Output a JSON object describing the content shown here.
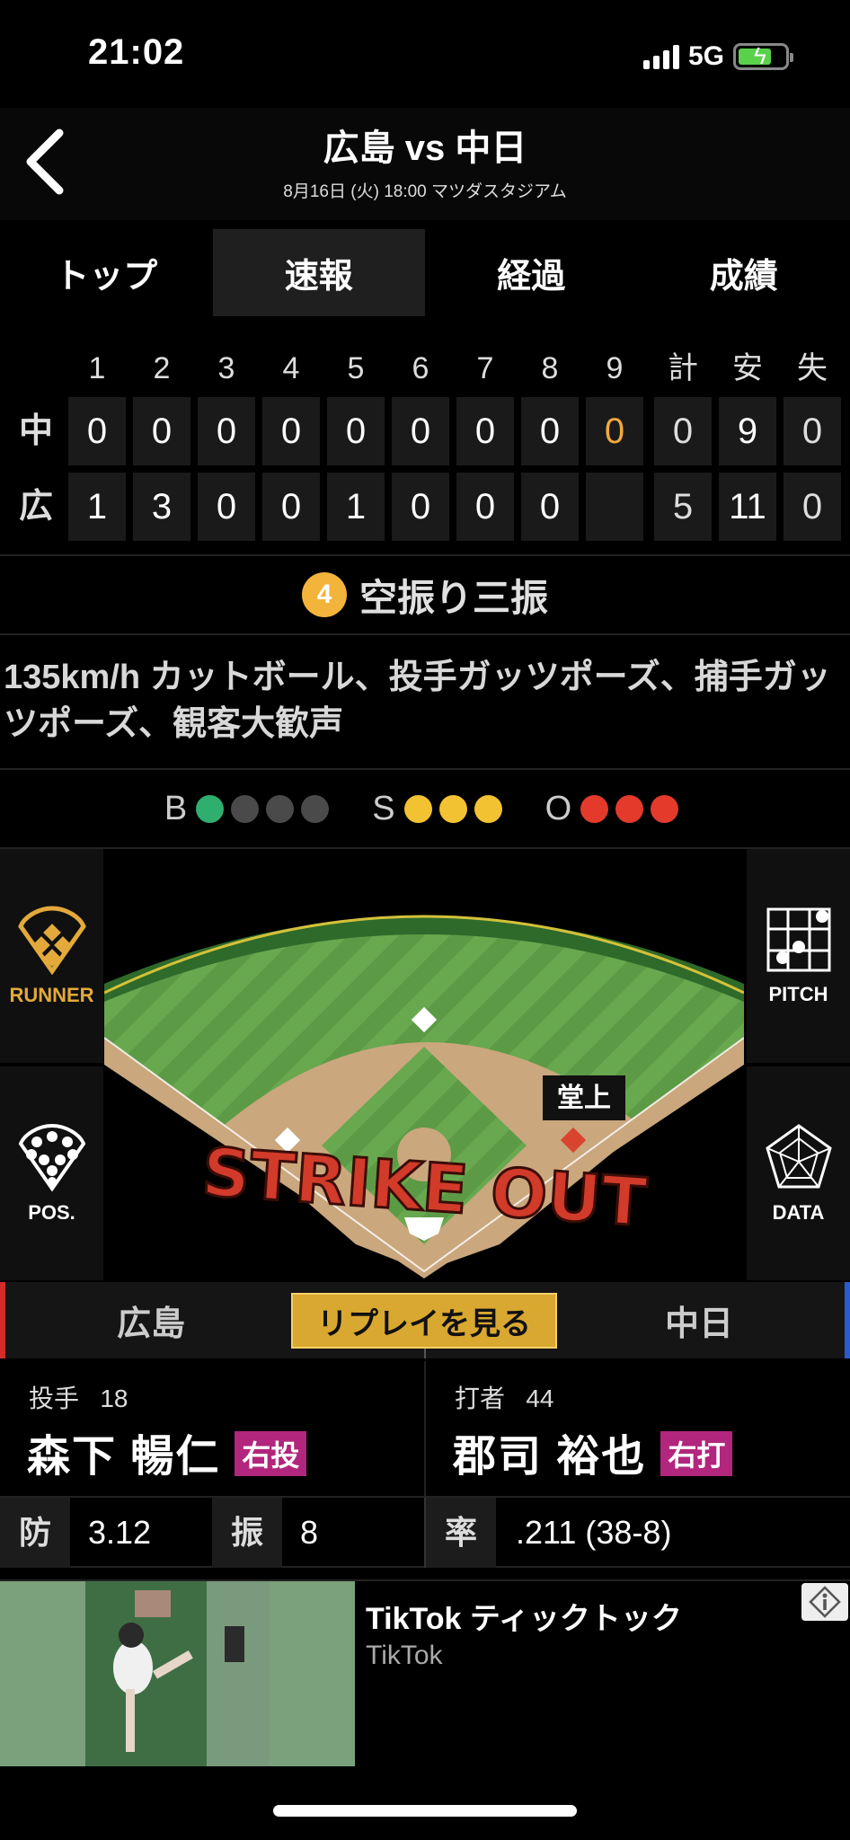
{
  "status_bar": {
    "time": "21:02",
    "network": "5G"
  },
  "header": {
    "title": "広島 vs 中日",
    "subtitle": "8月16日 (火) 18:00 マツダスタジアム"
  },
  "tabs": [
    {
      "label": "トップ",
      "active": false
    },
    {
      "label": "速報",
      "active": true
    },
    {
      "label": "経過",
      "active": false
    },
    {
      "label": "成績",
      "active": false
    }
  ],
  "scoreboard": {
    "headers": [
      "1",
      "2",
      "3",
      "4",
      "5",
      "6",
      "7",
      "8",
      "9",
      "計",
      "安",
      "失"
    ],
    "rows": [
      {
        "team": "中",
        "innings": [
          "0",
          "0",
          "0",
          "0",
          "0",
          "0",
          "0",
          "0",
          "0"
        ],
        "runs": "0",
        "hits": "9",
        "errors": "0"
      },
      {
        "team": "広",
        "innings": [
          "1",
          "3",
          "0",
          "0",
          "1",
          "0",
          "0",
          "0",
          ""
        ],
        "runs": "5",
        "hits": "11",
        "errors": "0"
      }
    ]
  },
  "play": {
    "batter_order": "4",
    "result": "空振り三振",
    "description": "135km/h カットボール、投手ガッツポーズ、捕手ガッツポーズ、観客大歓声"
  },
  "count": {
    "balls_label": "B",
    "balls": 1,
    "balls_max": 4,
    "strikes_label": "S",
    "strikes": 3,
    "strikes_max": 3,
    "outs_label": "O",
    "outs": 3,
    "outs_max": 3,
    "colors": {
      "ball": "#2fae6e",
      "strike": "#f3c232",
      "out": "#e33a2c",
      "empty": "#4a4a4a"
    }
  },
  "field": {
    "runner_label": "RUNNER",
    "pitch_label": "PITCH",
    "pos_label": "POS.",
    "data_label": "DATA",
    "fielder_tag": "堂上",
    "overlay_text": "STRIKE OUT"
  },
  "team_bar": {
    "home": "広島",
    "replay": "リプレイを見る",
    "away": "中日"
  },
  "pitcher": {
    "role": "投手",
    "number": "18",
    "name": "森下 暢仁",
    "hand": "右投"
  },
  "batter": {
    "role": "打者",
    "number": "44",
    "name": "郡司 裕也",
    "hand": "右打"
  },
  "stats": {
    "era_label": "防",
    "era": "3.12",
    "k_label": "振",
    "k": "8",
    "avg_label": "率",
    "avg": ".211 (38-8)"
  },
  "ad": {
    "title": "TikTok ティックトック",
    "advertiser": "TikTok"
  }
}
